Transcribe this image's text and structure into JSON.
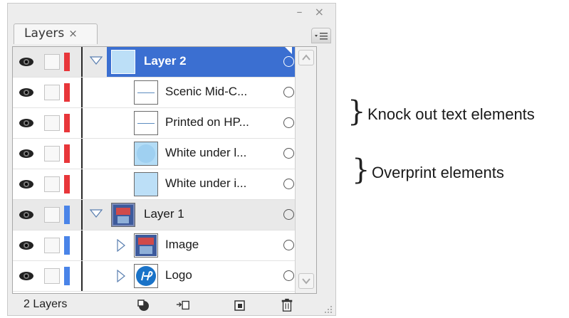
{
  "panel": {
    "window_controls": "– ×",
    "tab_label": "Layers",
    "tab_close": "×",
    "footer_count": "2 Layers"
  },
  "rows": [
    {
      "label": "Layer 2",
      "kind": "layer",
      "selected": true,
      "color": "#e8363a"
    },
    {
      "label": "Scenic Mid-C...",
      "kind": "sublayer",
      "color": "#e8363a"
    },
    {
      "label": "Printed on HP...",
      "kind": "sublayer",
      "color": "#e8363a"
    },
    {
      "label": "White under l...",
      "kind": "sublayer",
      "color": "#e8363a"
    },
    {
      "label": "White under i...",
      "kind": "sublayer",
      "color": "#e8363a"
    },
    {
      "label": "Layer 1",
      "kind": "layer",
      "color": "#4a84e8"
    },
    {
      "label": "Image",
      "kind": "sublayer-group",
      "color": "#4a84e8"
    },
    {
      "label": "Logo",
      "kind": "sublayer-group",
      "color": "#4a84e8"
    }
  ],
  "annotations": {
    "knock_out": "Knock out text elements",
    "overprint": "Overprint elements"
  },
  "colors": {
    "selection": "#3b6fd1",
    "layer2_color": "#e8363a",
    "layer1_color": "#4a84e8"
  }
}
